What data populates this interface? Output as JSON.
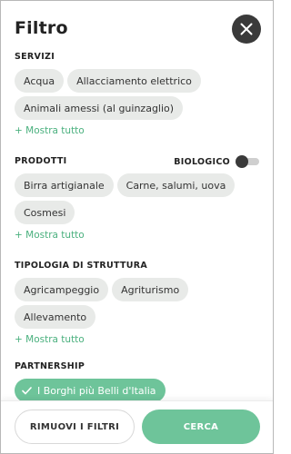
{
  "header": {
    "title": "Filtro"
  },
  "sections": [
    {
      "title": "SERVIZI",
      "chips": [
        "Acqua",
        "Allacciamento elettrico",
        "Animali amessi (al guinzaglio)"
      ],
      "show_all": "+ Mostra tutto"
    },
    {
      "title": "PRODOTTI",
      "toggle_label": "BIOLOGICO",
      "toggle_on": false,
      "chips": [
        "Birra artigianale",
        "Carne, salumi, uova",
        "Cosmesi"
      ],
      "show_all": "+ Mostra tutto"
    },
    {
      "title": "TIPOLOGIA DI STRUTTURA",
      "chips": [
        "Agricampeggio",
        "Agriturismo",
        "Allevamento"
      ],
      "show_all": "+ Mostra tutto"
    },
    {
      "title": "PARTNERSHIP",
      "chips": [
        "I Borghi più Belli d'Italia"
      ],
      "selected_chip": "I Borghi più Belli d'Italia"
    }
  ],
  "footer": {
    "reset_label": "RIMUOVI I FILTRI",
    "search_label": "CERCA"
  },
  "colors": {
    "accent": "#6ec49a",
    "link": "#4ab07e",
    "chip_bg": "#e8eae8",
    "dark": "#3a3a3a"
  },
  "icons": {
    "close": "close-icon",
    "check": "check-icon"
  }
}
